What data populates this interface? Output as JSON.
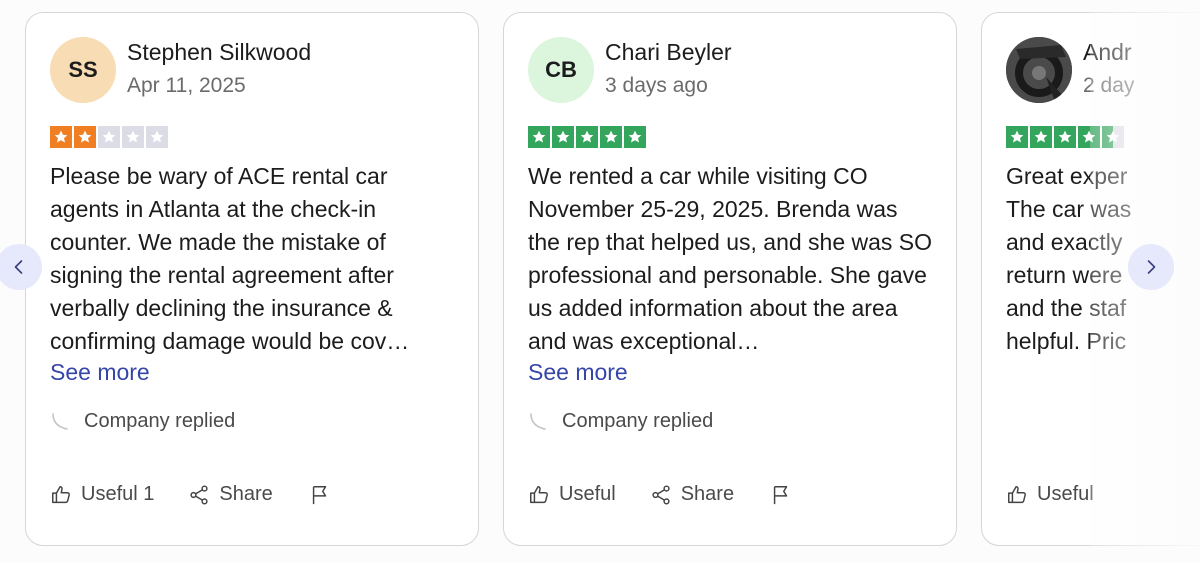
{
  "colors": {
    "star_orange": "#f07f23",
    "star_green": "#34a55c",
    "star_empty": "#dcdce6",
    "link": "#3646a8"
  },
  "reviews": [
    {
      "initials": "SS",
      "name": "Stephen Silkwood",
      "date": "Apr 11, 2025",
      "rating": 2,
      "text": "Please be wary of ACE rental car agents in Atlanta at the check-in counter. We made the mistake of signing the rental agreement after verbally declining the insurance & confirming damage would be cov…",
      "see_more": "See more",
      "replied": "Company replied",
      "useful": "Useful 1",
      "share": "Share"
    },
    {
      "initials": "CB",
      "name": "Chari Beyler",
      "date": "3 days ago",
      "rating": 5,
      "text": "We rented a car while visiting CO November 25-29, 2025. Brenda was the rep that helped us, and she was SO professional and personable. She gave us added information about the area and was exceptional…",
      "see_more": "See more",
      "replied": "Company replied",
      "useful": "Useful",
      "share": "Share"
    },
    {
      "name": "Andr",
      "date": "2 day",
      "rating": 4.5,
      "text": "Great exper The car was and exactly return were and the staf helpful. Pric",
      "useful": "Useful"
    }
  ],
  "icons": {
    "prev": "chevron-left-icon",
    "next": "chevron-right-icon",
    "useful": "thumbs-up-icon",
    "share": "share-icon",
    "flag": "flag-icon",
    "reply": "reply-hook-icon"
  }
}
